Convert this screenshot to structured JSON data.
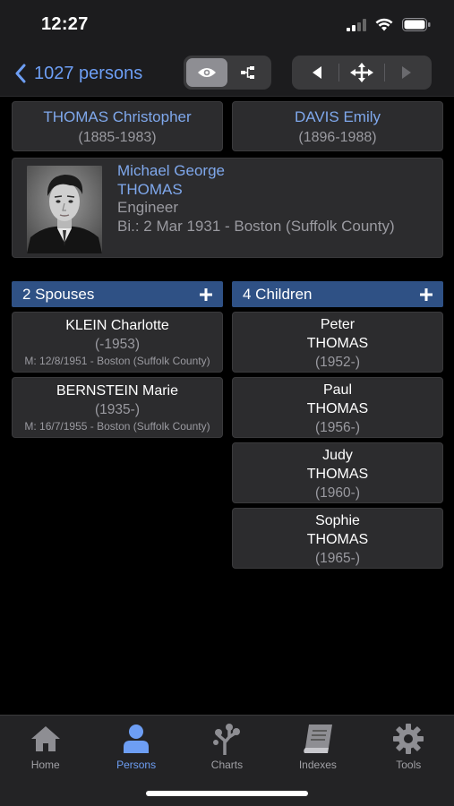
{
  "status_bar": {
    "time": "12:27"
  },
  "nav": {
    "back_label": "1027 persons",
    "view_segment": [
      "eye-icon",
      "tree-icon"
    ],
    "nav_segment": [
      "prev-arrow-icon",
      "tree-center-icon",
      "next-arrow-icon"
    ]
  },
  "parents": {
    "father": {
      "name": "THOMAS Christopher",
      "dates": "(1885-1983)"
    },
    "mother": {
      "name": "DAVIS Emily",
      "dates": "(1896-1988)"
    }
  },
  "person": {
    "given_names": "Michael George",
    "surname": "THOMAS",
    "occupation": "Engineer",
    "birth": "Bi.: 2 Mar 1931 - Boston (Suffolk County)"
  },
  "spouses": {
    "header": "2 Spouses",
    "items": [
      {
        "name": "KLEIN Charlotte",
        "dates": "(-1953)",
        "marriage": "M: 12/8/1951 - Boston (Suffolk County)"
      },
      {
        "name": "BERNSTEIN Marie",
        "dates": "(1935-)",
        "marriage": "M: 16/7/1955 - Boston (Suffolk County)"
      }
    ]
  },
  "children": {
    "header": "4 Children",
    "items": [
      {
        "given": "Peter",
        "surname": "THOMAS",
        "dates": "(1952-)"
      },
      {
        "given": "Paul",
        "surname": "THOMAS",
        "dates": "(1956-)"
      },
      {
        "given": "Judy",
        "surname": "THOMAS",
        "dates": "(1960-)"
      },
      {
        "given": "Sophie",
        "surname": "THOMAS",
        "dates": "(1965-)"
      }
    ]
  },
  "tabs": [
    {
      "label": "Home",
      "icon": "home-icon"
    },
    {
      "label": "Persons",
      "icon": "person-icon",
      "active": true
    },
    {
      "label": "Charts",
      "icon": "charts-icon"
    },
    {
      "label": "Indexes",
      "icon": "book-icon"
    },
    {
      "label": "Tools",
      "icon": "gear-icon"
    }
  ],
  "colors": {
    "accent": "#6d9ef4",
    "link": "#7fa8ec",
    "section_header": "#2f5185",
    "card": "#2c2c2e"
  }
}
